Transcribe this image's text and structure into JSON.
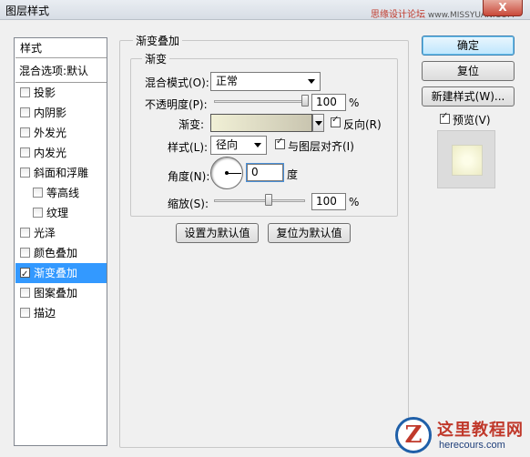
{
  "window": {
    "title": "图层样式",
    "watermark_text": "思缘设计论坛",
    "watermark_url": "www.MISSYUAN.COM",
    "close_label": "X"
  },
  "style_list": {
    "header": "样式",
    "blend_options": "混合选项:默认",
    "items": [
      {
        "label": "投影",
        "checked": false
      },
      {
        "label": "内阴影",
        "checked": false
      },
      {
        "label": "外发光",
        "checked": false
      },
      {
        "label": "内发光",
        "checked": false
      },
      {
        "label": "斜面和浮雕",
        "checked": false
      },
      {
        "label": "等高线",
        "checked": false
      },
      {
        "label": "纹理",
        "checked": false
      },
      {
        "label": "光泽",
        "checked": false
      },
      {
        "label": "颜色叠加",
        "checked": false
      },
      {
        "label": "渐变叠加",
        "checked": true
      },
      {
        "label": "图案叠加",
        "checked": false
      },
      {
        "label": "描边",
        "checked": false
      }
    ]
  },
  "gradient_overlay": {
    "group_title": "渐变叠加",
    "subgroup_title": "渐变",
    "blend_mode_label": "混合模式(O):",
    "blend_mode_value": "正常",
    "opacity_label": "不透明度(P):",
    "opacity_value": "100",
    "opacity_unit": "%",
    "opacity_level": 1.0,
    "gradient_label": "渐变:",
    "reverse_label": "反向(R)",
    "reverse_checked": true,
    "style_label": "样式(L):",
    "style_value": "径向",
    "align_label": "与图层对齐(I)",
    "align_checked": true,
    "angle_label": "角度(N):",
    "angle_value": "0",
    "angle_unit": "度",
    "scale_label": "缩放(S):",
    "scale_value": "100",
    "scale_unit": "%",
    "scale_level": 0.6,
    "make_default_label": "设置为默认值",
    "reset_default_label": "复位为默认值"
  },
  "side_buttons": {
    "ok_label": "确定",
    "reset_label": "复位",
    "new_style_label": "新建样式(W)...",
    "preview_label": "预览(V)",
    "preview_checked": true
  },
  "logo": {
    "mark": "Z",
    "name_cn": "这里教程网",
    "name_en": "herecours.com"
  }
}
